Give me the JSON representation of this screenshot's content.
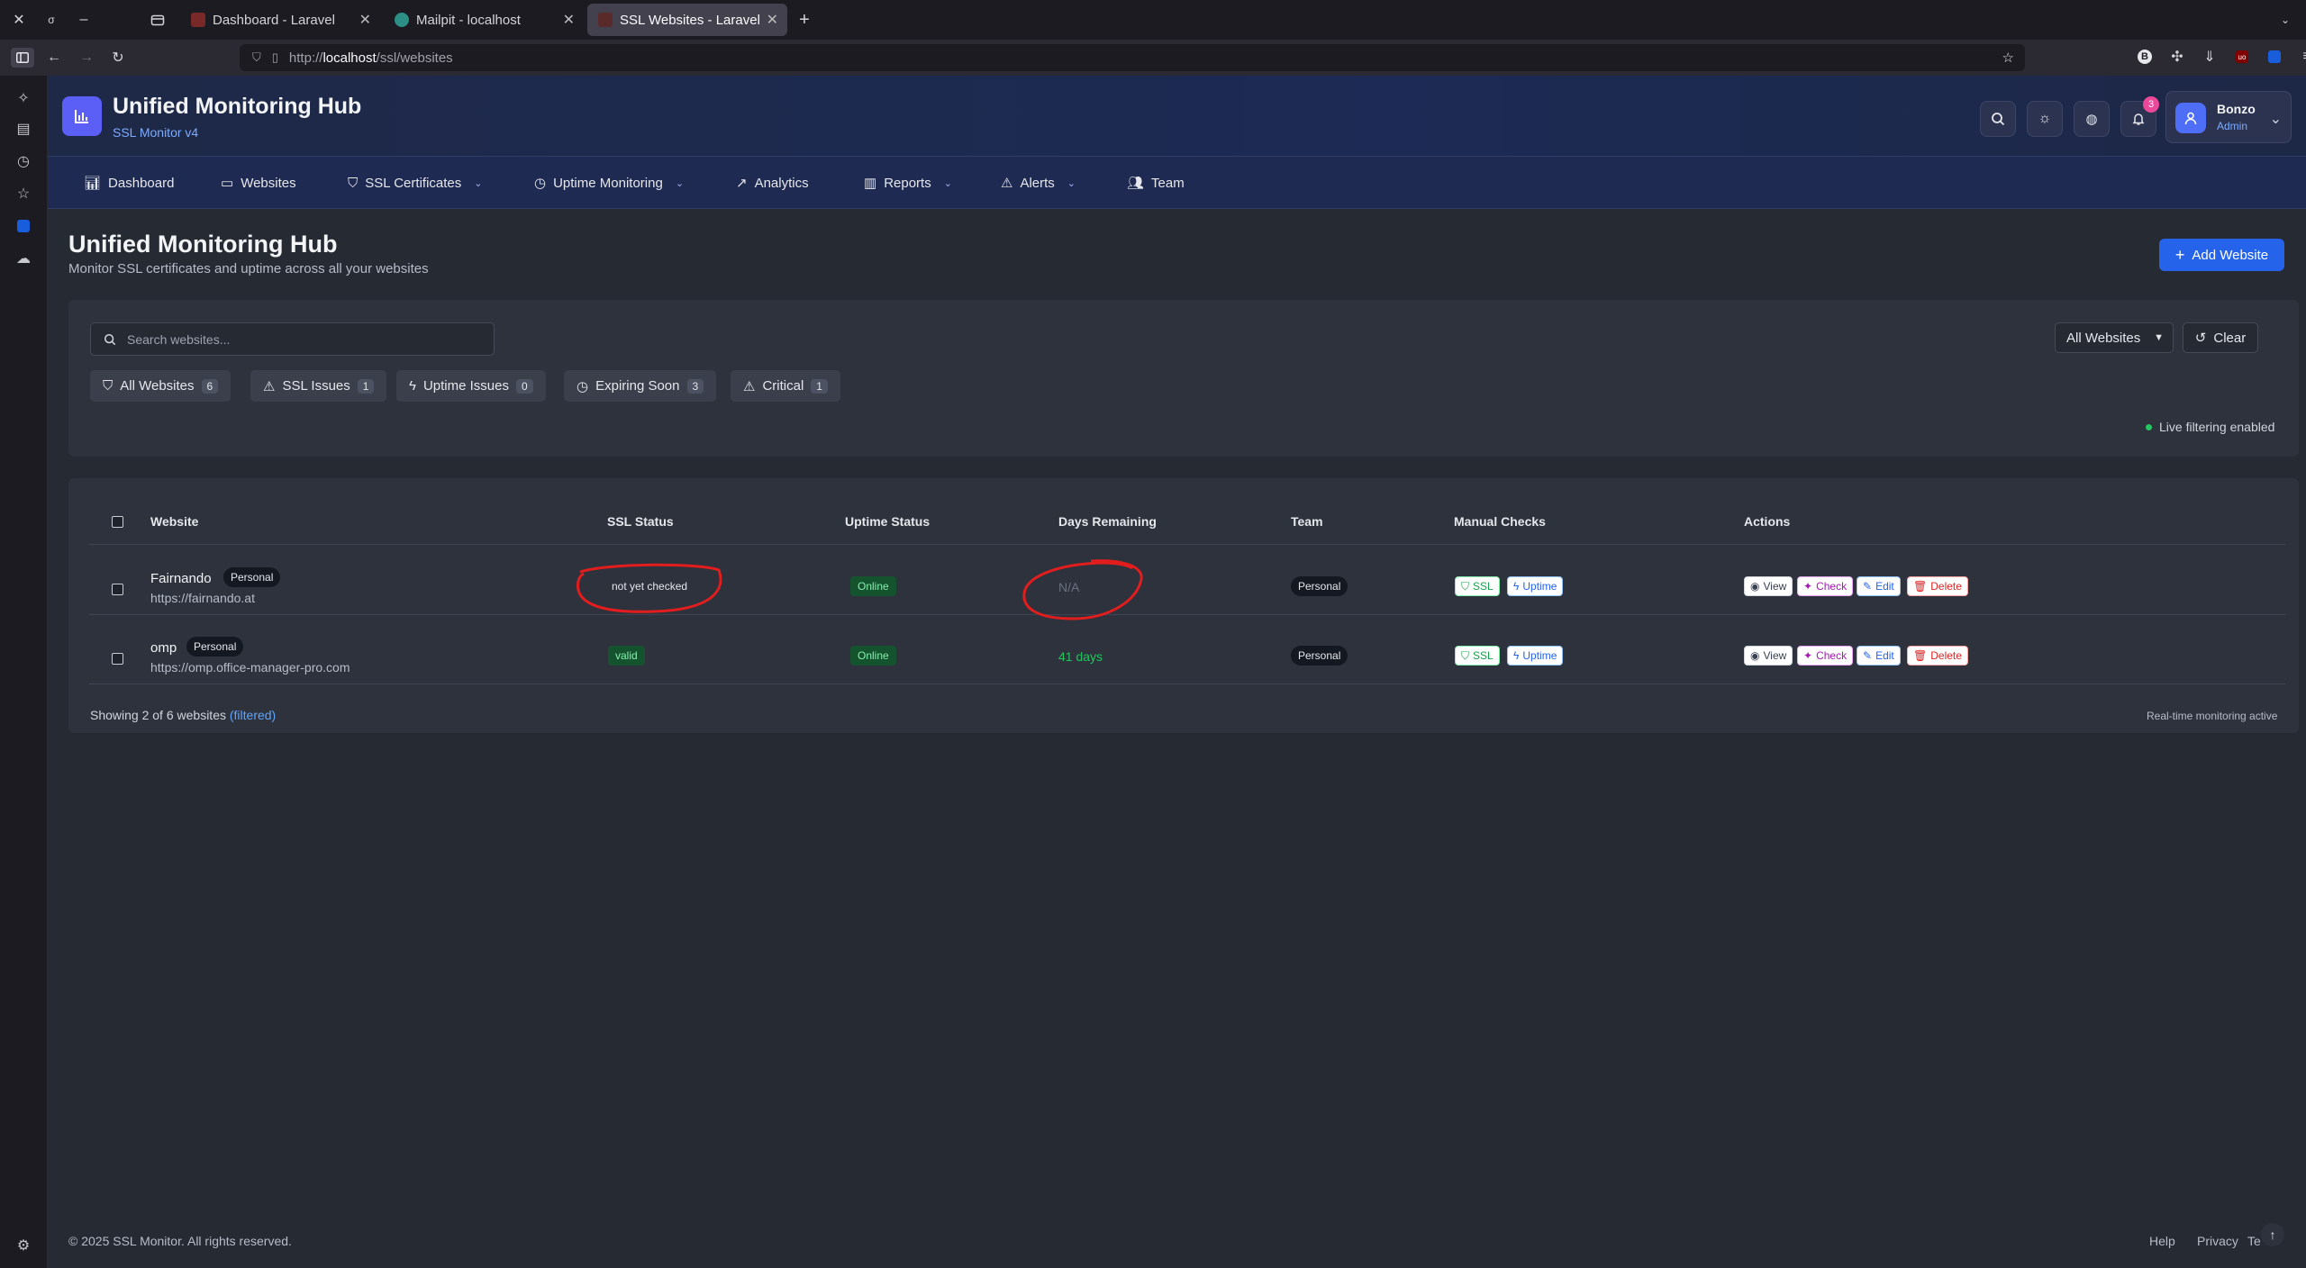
{
  "browser": {
    "tabs": [
      {
        "title": "Dashboard - Laravel"
      },
      {
        "title": "Mailpit - localhost"
      },
      {
        "title": "SSL Websites - Laravel"
      }
    ],
    "url_prefix": "http://",
    "url_host": "localhost",
    "url_path": "/ssl/websites"
  },
  "header": {
    "title": "Unified Monitoring Hub",
    "subtitle": "SSL Monitor v4",
    "notification_count": "3",
    "user_name": "Bonzo",
    "user_role": "Admin"
  },
  "nav": {
    "items": [
      {
        "label": "Dashboard",
        "icon": "bar-chart-icon"
      },
      {
        "label": "Websites",
        "icon": "monitor-icon"
      },
      {
        "label": "SSL Certificates",
        "icon": "shield-icon"
      },
      {
        "label": "Uptime Monitoring",
        "icon": "clock-icon"
      },
      {
        "label": "Analytics",
        "icon": "trend-icon"
      },
      {
        "label": "Reports",
        "icon": "bar-chart-icon"
      },
      {
        "label": "Alerts",
        "icon": "warning-icon"
      },
      {
        "label": "Team",
        "icon": "users-icon"
      }
    ]
  },
  "page": {
    "title": "Unified Monitoring Hub",
    "subtitle": "Monitor SSL certificates and uptime across all your websites",
    "add_button": "Add Website"
  },
  "filters": {
    "search_placeholder": "Search websites...",
    "select_value": "All Websites",
    "clear_label": "Clear",
    "chips": [
      {
        "label": "All Websites",
        "count": "6"
      },
      {
        "label": "SSL Issues",
        "count": "1"
      },
      {
        "label": "Uptime Issues",
        "count": "0"
      },
      {
        "label": "Expiring Soon",
        "count": "3"
      },
      {
        "label": "Critical",
        "count": "1"
      }
    ],
    "live_label": "Live filtering enabled"
  },
  "table": {
    "headers": [
      "Website",
      "SSL Status",
      "Uptime Status",
      "Days Remaining",
      "Team",
      "Manual Checks",
      "Actions"
    ],
    "rows": [
      {
        "name": "Fairnando",
        "tag": "Personal",
        "url": "https://fairnando.at",
        "ssl": "not yet checked",
        "uptime": "Online",
        "days": "N/A",
        "team": "Personal"
      },
      {
        "name": "omp",
        "tag": "Personal",
        "url": "https://omp.office-manager-pro.com",
        "ssl": "valid",
        "uptime": "Online",
        "days": "41 days",
        "team": "Personal"
      }
    ],
    "check_ssl": "SSL",
    "check_uptime": "Uptime",
    "action_view": "View",
    "action_check": "Check",
    "action_edit": "Edit",
    "action_delete": "Delete",
    "showing_text": "Showing 2 of 6 websites",
    "filtered_text": "(filtered)",
    "realtime_text": "Real-time monitoring active"
  },
  "footer": {
    "copyright": "© 2025 SSL Monitor. All rights reserved.",
    "links": [
      "Help",
      "Privacy",
      "Te"
    ]
  },
  "colors": {
    "accent": "#2563eb",
    "annotation": "#e11d1d",
    "online_green": "#86efac",
    "days_green": "#22c55e"
  }
}
